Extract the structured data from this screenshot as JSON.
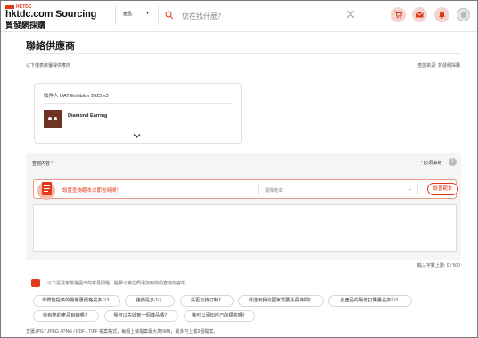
{
  "brand": {
    "badge": "HKTDC",
    "name": "hktdc.com Sourcing",
    "subname": "貿發網採購"
  },
  "search": {
    "scope": "產品",
    "placeholder": "您在找什麼？"
  },
  "header_icons": [
    "cart-icon",
    "mail-icon",
    "bell-icon",
    "user-icon"
  ],
  "page": {
    "title": "聯絡供應商",
    "intro": "以下僅表將獲得供應商",
    "source": "查詢來源: 貿發網採購"
  },
  "recipient": {
    "label": "收件人 UAT Exhibitor 2023 v3",
    "product": "Diamond Earring"
  },
  "enquiry": {
    "label": "查詢內容",
    "required_mark": "*",
    "required_note": "* 必須填寫",
    "info": "i",
    "template_prompt": "設置查詢範本以節省時間！",
    "template_select_placeholder": "選擇範本",
    "template_button": "設置範本",
    "counter": "輸入字數上限: 0 / 500"
  },
  "suggestions": {
    "header": "以下是買家最常提出的常見問題，點擊以將它們添加到你的查詢內容中。",
    "chips": [
      "你們能提供的最優惠價格是多少？",
      "議價是多少？",
      "是否支持訂制？",
      "運送到我的國家需要多長時間？",
      "此產品的最低訂購量是多少？",
      "你有熱的產品目錄嗎？",
      "我可以先收到一個樣品嗎？",
      "我可以添加自己的標誌嗎？"
    ]
  },
  "footer_note": "支援JPG / JPEG / PNG / PDF / TIFF 檔案格式，每個上載檔案最大為5MB，最多可上載3個檔案。",
  "colors": {
    "accent": "#e03a1a",
    "icon_bg": "#f3d6d0"
  }
}
